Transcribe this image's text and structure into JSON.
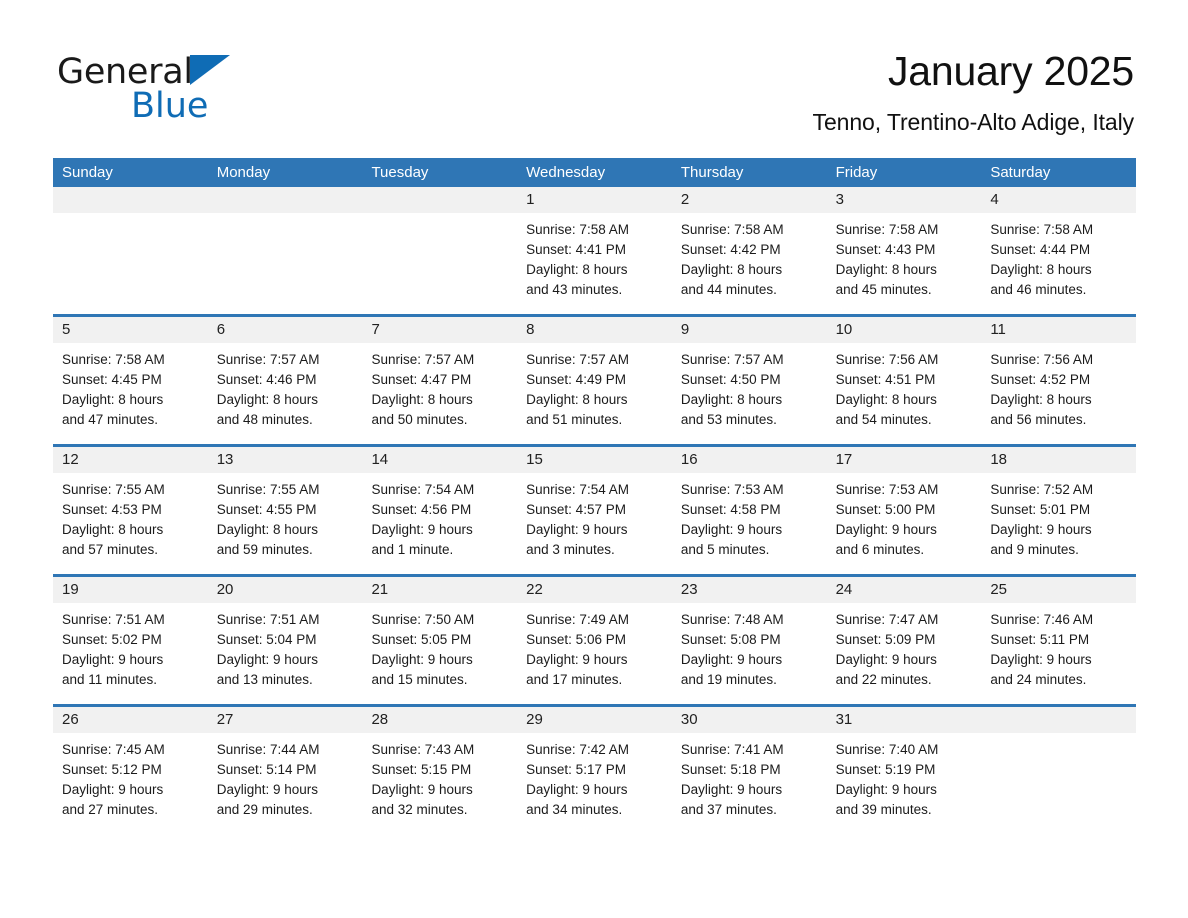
{
  "brand": {
    "name_part1": "General",
    "name_part2": "Blue",
    "flag_icon": "triangle-flag-icon",
    "accent_color": "#0f6cb5"
  },
  "header": {
    "title": "January 2025",
    "subtitle": "Tenno, Trentino-Alto Adige, Italy"
  },
  "theme": {
    "header_blue": "#2f76b5",
    "day_band_gray": "#f1f1f1",
    "text": "#1b1b1b"
  },
  "weekdays": [
    "Sunday",
    "Monday",
    "Tuesday",
    "Wednesday",
    "Thursday",
    "Friday",
    "Saturday"
  ],
  "weeks": [
    [
      {
        "day": "",
        "empty": true,
        "sunrise": "",
        "sunset": "",
        "daylight1": "",
        "daylight2": ""
      },
      {
        "day": "",
        "empty": true,
        "sunrise": "",
        "sunset": "",
        "daylight1": "",
        "daylight2": ""
      },
      {
        "day": "",
        "empty": true,
        "sunrise": "",
        "sunset": "",
        "daylight1": "",
        "daylight2": ""
      },
      {
        "day": "1",
        "empty": false,
        "sunrise": "Sunrise: 7:58 AM",
        "sunset": "Sunset: 4:41 PM",
        "daylight1": "Daylight: 8 hours",
        "daylight2": "and 43 minutes."
      },
      {
        "day": "2",
        "empty": false,
        "sunrise": "Sunrise: 7:58 AM",
        "sunset": "Sunset: 4:42 PM",
        "daylight1": "Daylight: 8 hours",
        "daylight2": "and 44 minutes."
      },
      {
        "day": "3",
        "empty": false,
        "sunrise": "Sunrise: 7:58 AM",
        "sunset": "Sunset: 4:43 PM",
        "daylight1": "Daylight: 8 hours",
        "daylight2": "and 45 minutes."
      },
      {
        "day": "4",
        "empty": false,
        "sunrise": "Sunrise: 7:58 AM",
        "sunset": "Sunset: 4:44 PM",
        "daylight1": "Daylight: 8 hours",
        "daylight2": "and 46 minutes."
      }
    ],
    [
      {
        "day": "5",
        "empty": false,
        "sunrise": "Sunrise: 7:58 AM",
        "sunset": "Sunset: 4:45 PM",
        "daylight1": "Daylight: 8 hours",
        "daylight2": "and 47 minutes."
      },
      {
        "day": "6",
        "empty": false,
        "sunrise": "Sunrise: 7:57 AM",
        "sunset": "Sunset: 4:46 PM",
        "daylight1": "Daylight: 8 hours",
        "daylight2": "and 48 minutes."
      },
      {
        "day": "7",
        "empty": false,
        "sunrise": "Sunrise: 7:57 AM",
        "sunset": "Sunset: 4:47 PM",
        "daylight1": "Daylight: 8 hours",
        "daylight2": "and 50 minutes."
      },
      {
        "day": "8",
        "empty": false,
        "sunrise": "Sunrise: 7:57 AM",
        "sunset": "Sunset: 4:49 PM",
        "daylight1": "Daylight: 8 hours",
        "daylight2": "and 51 minutes."
      },
      {
        "day": "9",
        "empty": false,
        "sunrise": "Sunrise: 7:57 AM",
        "sunset": "Sunset: 4:50 PM",
        "daylight1": "Daylight: 8 hours",
        "daylight2": "and 53 minutes."
      },
      {
        "day": "10",
        "empty": false,
        "sunrise": "Sunrise: 7:56 AM",
        "sunset": "Sunset: 4:51 PM",
        "daylight1": "Daylight: 8 hours",
        "daylight2": "and 54 minutes."
      },
      {
        "day": "11",
        "empty": false,
        "sunrise": "Sunrise: 7:56 AM",
        "sunset": "Sunset: 4:52 PM",
        "daylight1": "Daylight: 8 hours",
        "daylight2": "and 56 minutes."
      }
    ],
    [
      {
        "day": "12",
        "empty": false,
        "sunrise": "Sunrise: 7:55 AM",
        "sunset": "Sunset: 4:53 PM",
        "daylight1": "Daylight: 8 hours",
        "daylight2": "and 57 minutes."
      },
      {
        "day": "13",
        "empty": false,
        "sunrise": "Sunrise: 7:55 AM",
        "sunset": "Sunset: 4:55 PM",
        "daylight1": "Daylight: 8 hours",
        "daylight2": "and 59 minutes."
      },
      {
        "day": "14",
        "empty": false,
        "sunrise": "Sunrise: 7:54 AM",
        "sunset": "Sunset: 4:56 PM",
        "daylight1": "Daylight: 9 hours",
        "daylight2": "and 1 minute."
      },
      {
        "day": "15",
        "empty": false,
        "sunrise": "Sunrise: 7:54 AM",
        "sunset": "Sunset: 4:57 PM",
        "daylight1": "Daylight: 9 hours",
        "daylight2": "and 3 minutes."
      },
      {
        "day": "16",
        "empty": false,
        "sunrise": "Sunrise: 7:53 AM",
        "sunset": "Sunset: 4:58 PM",
        "daylight1": "Daylight: 9 hours",
        "daylight2": "and 5 minutes."
      },
      {
        "day": "17",
        "empty": false,
        "sunrise": "Sunrise: 7:53 AM",
        "sunset": "Sunset: 5:00 PM",
        "daylight1": "Daylight: 9 hours",
        "daylight2": "and 6 minutes."
      },
      {
        "day": "18",
        "empty": false,
        "sunrise": "Sunrise: 7:52 AM",
        "sunset": "Sunset: 5:01 PM",
        "daylight1": "Daylight: 9 hours",
        "daylight2": "and 9 minutes."
      }
    ],
    [
      {
        "day": "19",
        "empty": false,
        "sunrise": "Sunrise: 7:51 AM",
        "sunset": "Sunset: 5:02 PM",
        "daylight1": "Daylight: 9 hours",
        "daylight2": "and 11 minutes."
      },
      {
        "day": "20",
        "empty": false,
        "sunrise": "Sunrise: 7:51 AM",
        "sunset": "Sunset: 5:04 PM",
        "daylight1": "Daylight: 9 hours",
        "daylight2": "and 13 minutes."
      },
      {
        "day": "21",
        "empty": false,
        "sunrise": "Sunrise: 7:50 AM",
        "sunset": "Sunset: 5:05 PM",
        "daylight1": "Daylight: 9 hours",
        "daylight2": "and 15 minutes."
      },
      {
        "day": "22",
        "empty": false,
        "sunrise": "Sunrise: 7:49 AM",
        "sunset": "Sunset: 5:06 PM",
        "daylight1": "Daylight: 9 hours",
        "daylight2": "and 17 minutes."
      },
      {
        "day": "23",
        "empty": false,
        "sunrise": "Sunrise: 7:48 AM",
        "sunset": "Sunset: 5:08 PM",
        "daylight1": "Daylight: 9 hours",
        "daylight2": "and 19 minutes."
      },
      {
        "day": "24",
        "empty": false,
        "sunrise": "Sunrise: 7:47 AM",
        "sunset": "Sunset: 5:09 PM",
        "daylight1": "Daylight: 9 hours",
        "daylight2": "and 22 minutes."
      },
      {
        "day": "25",
        "empty": false,
        "sunrise": "Sunrise: 7:46 AM",
        "sunset": "Sunset: 5:11 PM",
        "daylight1": "Daylight: 9 hours",
        "daylight2": "and 24 minutes."
      }
    ],
    [
      {
        "day": "26",
        "empty": false,
        "sunrise": "Sunrise: 7:45 AM",
        "sunset": "Sunset: 5:12 PM",
        "daylight1": "Daylight: 9 hours",
        "daylight2": "and 27 minutes."
      },
      {
        "day": "27",
        "empty": false,
        "sunrise": "Sunrise: 7:44 AM",
        "sunset": "Sunset: 5:14 PM",
        "daylight1": "Daylight: 9 hours",
        "daylight2": "and 29 minutes."
      },
      {
        "day": "28",
        "empty": false,
        "sunrise": "Sunrise: 7:43 AM",
        "sunset": "Sunset: 5:15 PM",
        "daylight1": "Daylight: 9 hours",
        "daylight2": "and 32 minutes."
      },
      {
        "day": "29",
        "empty": false,
        "sunrise": "Sunrise: 7:42 AM",
        "sunset": "Sunset: 5:17 PM",
        "daylight1": "Daylight: 9 hours",
        "daylight2": "and 34 minutes."
      },
      {
        "day": "30",
        "empty": false,
        "sunrise": "Sunrise: 7:41 AM",
        "sunset": "Sunset: 5:18 PM",
        "daylight1": "Daylight: 9 hours",
        "daylight2": "and 37 minutes."
      },
      {
        "day": "31",
        "empty": false,
        "sunrise": "Sunrise: 7:40 AM",
        "sunset": "Sunset: 5:19 PM",
        "daylight1": "Daylight: 9 hours",
        "daylight2": "and 39 minutes."
      },
      {
        "day": "",
        "empty": true,
        "sunrise": "",
        "sunset": "",
        "daylight1": "",
        "daylight2": ""
      }
    ]
  ]
}
